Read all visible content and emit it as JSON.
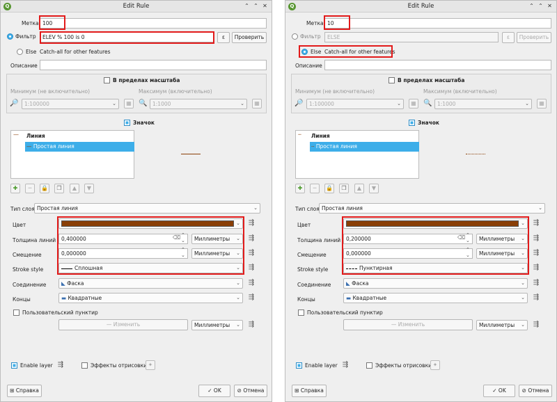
{
  "colors": {
    "highlight": "#e21a1a",
    "accent": "#3daee9",
    "stroke_brown": "#8a3f07"
  },
  "panels": [
    {
      "title": "Edit Rule",
      "label_caption": "Метка",
      "label_value": "100",
      "filter_caption": "Фильтр",
      "filter_value": "ELEV % 100 is 0",
      "filter_btn": "Проверить",
      "expr_btn": "ε",
      "else_caption": "Else",
      "else_desc": "Catch-all for other features",
      "desc_caption": "Описание",
      "scale_title": "В пределах масштаба",
      "min_caption": "Минимум (не включительно)",
      "max_caption": "Максимум (включительно)",
      "min_value": "1:100000",
      "max_value": "1:1000",
      "symbol_title": "Значок",
      "tree_root": "Линия",
      "tree_child": "Простая линия",
      "layer_type_caption": "Тип слоя",
      "layer_type_value": "Простая линия",
      "color_caption": "Цвет",
      "width_caption": "Толщина линий",
      "width_value": "0,400000",
      "width_unit": "Миллиметры",
      "offset_caption": "Смещение",
      "offset_value": "0,000000",
      "offset_unit": "Миллиметры",
      "stroke_caption": "Stroke style",
      "stroke_value": "Сплошная",
      "join_caption": "Соединение",
      "join_value": "Фаска",
      "cap_caption": "Концы",
      "cap_value": "Квадратные",
      "custom_dash": "Пользовательский пунктир",
      "change_btn": "Изменить",
      "dash_unit": "Миллиметры",
      "enable_layer": "Enable layer",
      "effects": "Эффекты отрисовки",
      "help_btn": "Справка",
      "ok_btn": "OK",
      "cancel_btn": "Отмена"
    },
    {
      "title": "Edit Rule",
      "label_caption": "Метка",
      "label_value": "10",
      "filter_caption": "Фильтр",
      "filter_value": "ELSE",
      "filter_btn": "Проверить",
      "expr_btn": "ε",
      "else_caption": "Else",
      "else_desc": "Catch-all for other features",
      "desc_caption": "Описание",
      "scale_title": "В пределах масштаба",
      "min_caption": "Минимум (не включительно)",
      "max_caption": "Максимум (включительно)",
      "min_value": "1:100000",
      "max_value": "1:1000",
      "symbol_title": "Значок",
      "tree_root": "Линия",
      "tree_child": "Простая линия",
      "layer_type_caption": "Тип слоя",
      "layer_type_value": "Простая линия",
      "color_caption": "Цвет",
      "width_caption": "Толщина линий",
      "width_value": "0,200000",
      "width_unit": "Миллиметры",
      "offset_caption": "Смещение",
      "offset_value": "0,000000",
      "offset_unit": "Миллиметры",
      "stroke_caption": "Stroke style",
      "stroke_value": "Пунктирная",
      "join_caption": "Соединение",
      "join_value": "Фаска",
      "cap_caption": "Концы",
      "cap_value": "Квадратные",
      "custom_dash": "Пользовательский пунктир",
      "change_btn": "Изменить",
      "dash_unit": "Миллиметры",
      "enable_layer": "Enable layer",
      "effects": "Эффекты отрисовки",
      "help_btn": "Справка",
      "ok_btn": "OK",
      "cancel_btn": "Отмена"
    }
  ]
}
